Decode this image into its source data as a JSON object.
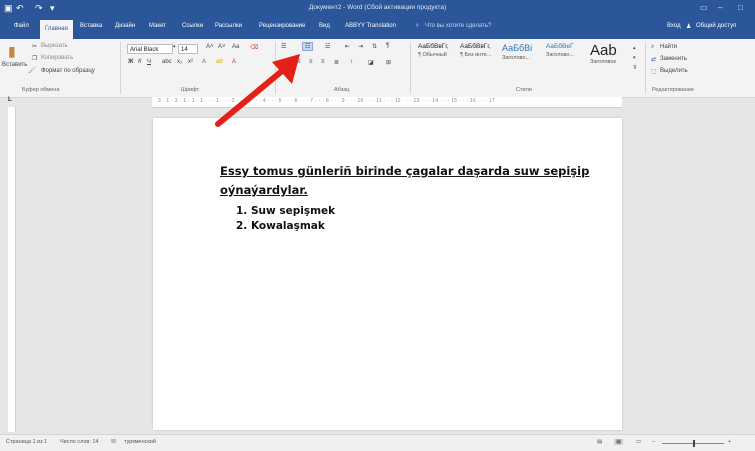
{
  "titlebar": {
    "title": "Документ2 - Word (Сбой активации продукта)",
    "save_icon": "save-icon",
    "undo_icon": "undo-icon",
    "redo_icon": "redo-icon"
  },
  "tabs": [
    "Файл",
    "Главная",
    "Вставка",
    "Дизайн",
    "Макет",
    "Ссылки",
    "Рассылки",
    "Рецензирование",
    "Вид",
    "ABBYY Translation"
  ],
  "tellme": "Что вы хотите сделать?",
  "signin": "Вход",
  "share": "Общий доступ",
  "clipboard": {
    "paste": "Вставить",
    "cut": "Вырезать",
    "copy": "Копировать",
    "format_painter": "Формат по образцу",
    "group": "Буфер обмена"
  },
  "font": {
    "name": "Arial Black",
    "size": "14",
    "group": "Шрифт",
    "case": "Aa"
  },
  "paragraph": {
    "group": "Абзац"
  },
  "styles": {
    "items": [
      {
        "sample": "АаБбВвГг,",
        "caption": "¶ Обычный"
      },
      {
        "sample": "АаБбВвГг,",
        "caption": "¶ Без инте..."
      },
      {
        "sample": "АаБбВі",
        "caption": "Заголово..."
      },
      {
        "sample": "АаБбВеГ",
        "caption": "Заголово..."
      },
      {
        "sample": "Aab",
        "caption": "Заголовок"
      }
    ],
    "group": "Стили"
  },
  "editing": {
    "find": "Найти",
    "replace": "Заменить",
    "select": "Выделить",
    "group": "Редактирование"
  },
  "ruler_numbers": "3 · 1 · 2 · 1 · 1 · 1 · · · 1 · · · 2 · · · 3 · · · 4 · · · 5 · · · 6 · · · 7 · · · 8 · · · 9 · · · 10 · · · 11 · · · 12 · · · 13 · · · 14 · · · 15 · · · 16 · · · 17",
  "document": {
    "heading": "Essy tomus günleriñ birinde çagalar daşarda suw sepişip oýnaýardylar.",
    "list": [
      "1. Suw sepişmek",
      "2. Kowalaşmak"
    ]
  },
  "status": {
    "page": "Страница 1 из 1",
    "words": "Число слов: 14",
    "lang": "туркменский"
  },
  "colors": {
    "accent": "#2b579a",
    "arrow": "#e32118"
  }
}
